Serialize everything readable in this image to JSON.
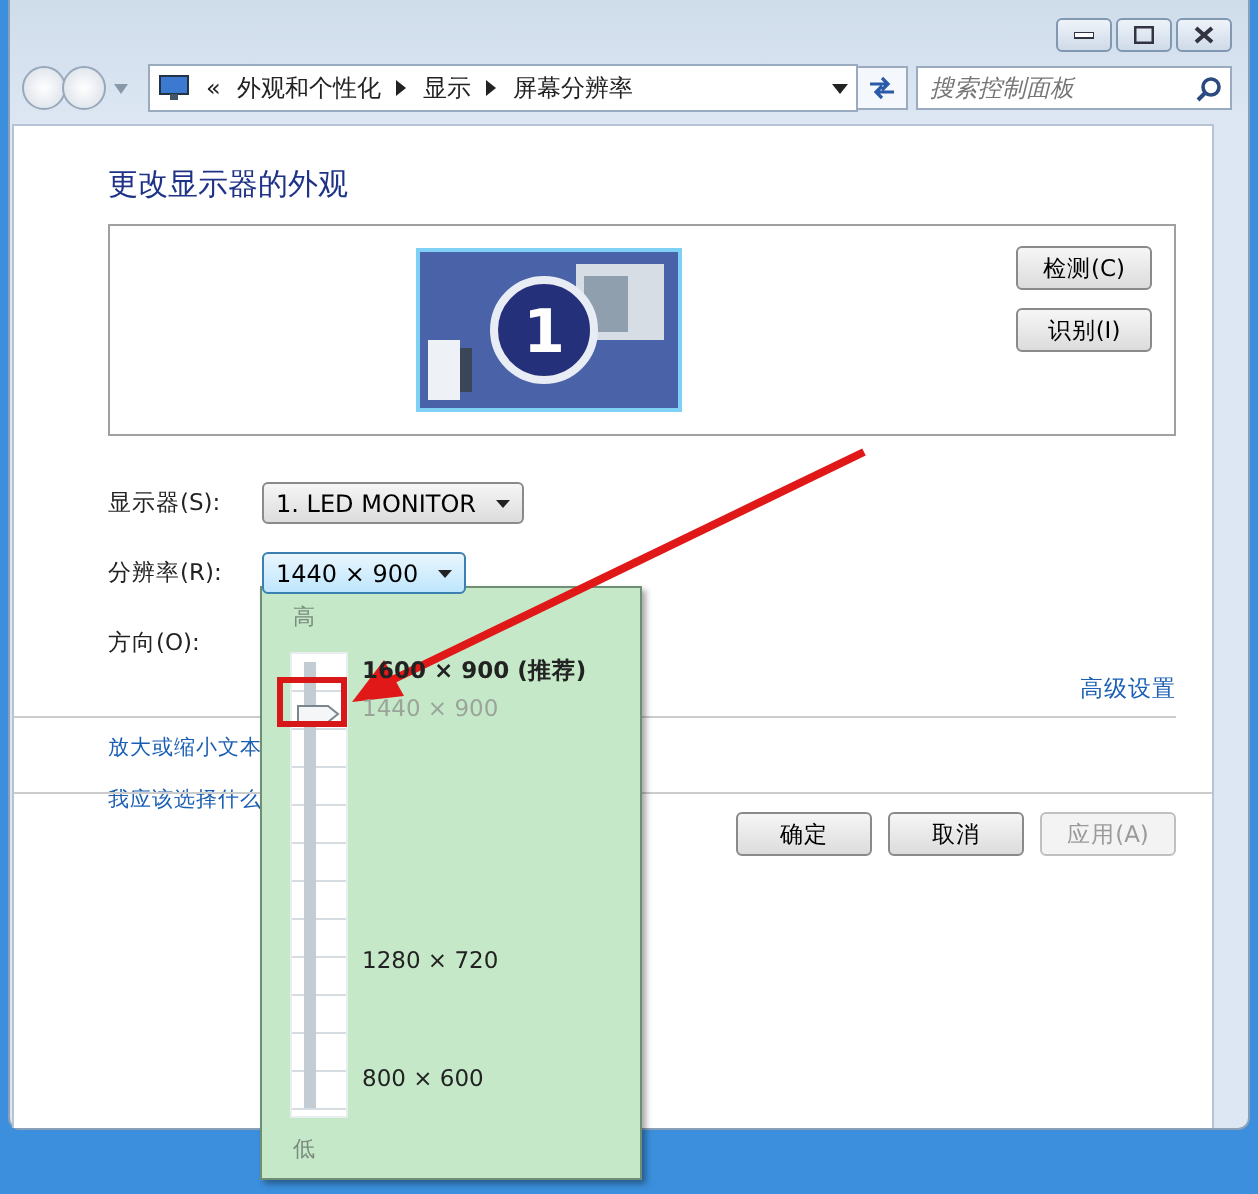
{
  "address_bar": {
    "prefix": "«",
    "crumbs": [
      "外观和个性化",
      "显示",
      "屏幕分辨率"
    ]
  },
  "search": {
    "placeholder": "搜索控制面板"
  },
  "heading": "更改显示器的外观",
  "monitor_panel": {
    "monitor_number": "1",
    "buttons": [
      "检测(C)",
      "识别(I)"
    ]
  },
  "settings": [
    {
      "label": "显示器(S):",
      "value": "1. LED MONITOR",
      "open": false
    },
    {
      "label": "分辨率(R):",
      "value": "1440 × 900",
      "open": true
    },
    {
      "label": "方向(O):"
    }
  ],
  "advanced_link": "高级设置",
  "links": [
    "放大或缩小文本",
    "我应该选择什么"
  ],
  "buttons": [
    {
      "label": "确定",
      "disabled": false
    },
    {
      "label": "取消",
      "disabled": false
    },
    {
      "label": "应用(A)",
      "disabled": true
    }
  ],
  "resolution_popup": {
    "top_label": "高",
    "bottom_label": "低",
    "level": 0.87,
    "options": [
      {
        "label": "1600 × 900 (推荐)",
        "recommended": true,
        "selected": false
      },
      {
        "label": "1440 × 900",
        "recommended": false,
        "selected": true
      },
      {
        "label": "1280 × 720",
        "recommended": false,
        "selected": false
      },
      {
        "label": "800 × 600",
        "recommended": false,
        "selected": false
      }
    ]
  }
}
